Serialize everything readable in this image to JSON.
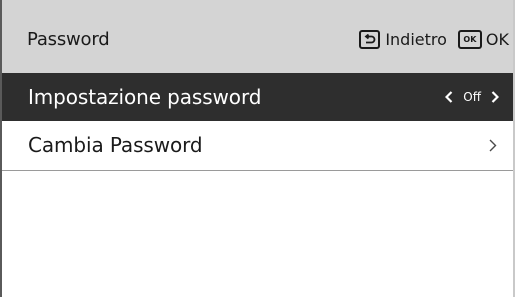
{
  "header": {
    "title": "Password",
    "back_label": "Indietro",
    "ok_key_text": "OK",
    "ok_label": "OK"
  },
  "menu": {
    "items": [
      {
        "label": "Impostazione password",
        "value": "Off",
        "selected": true,
        "icon_left": "chevron-left-icon",
        "icon_right": "chevron-right-icon"
      },
      {
        "label": "Cambia Password",
        "selected": false,
        "icon_right": "chevron-right-icon"
      }
    ]
  },
  "colors": {
    "header_bg": "#d4d4d4",
    "selected_bg": "#2e2e2e",
    "selected_text": "#ffffff",
    "text": "#1a1a1a",
    "background": "#ffffff"
  }
}
